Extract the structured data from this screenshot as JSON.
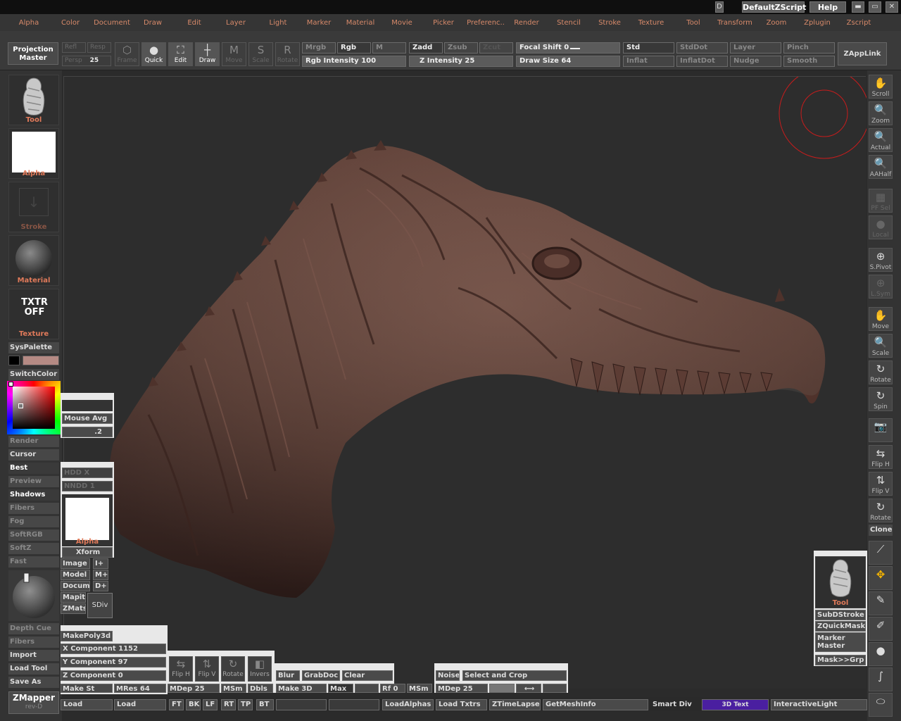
{
  "titlebar": {
    "script_name": "DefaultZScript",
    "help": "Help",
    "win_min": "▬",
    "win_max": "▭",
    "win_close": "✕",
    "d_label": "D"
  },
  "menus": [
    "Alpha",
    "Color",
    "Document",
    "Draw",
    "Edit",
    "Layer",
    "Light",
    "Marker",
    "Material",
    "Movie",
    "Picker",
    "Preferenc..",
    "Render",
    "Stencil",
    "Stroke",
    "Texture",
    "Tool",
    "Transform",
    "Zoom",
    "Zplugin",
    "Zscript"
  ],
  "toolbar": {
    "projection_master": "Projection Master",
    "refl": "Refl",
    "resp": "Resp",
    "persp": "Persp",
    "persp_value": "25",
    "frame": "Frame",
    "quick": "Quick",
    "edit": "Edit",
    "draw": "Draw",
    "move": "Move",
    "scale": "Scale",
    "rotate": "Rotate",
    "mrgb": "Mrgb",
    "rgb": "Rgb",
    "m": "M",
    "zadd": "Zadd",
    "zsub": "Zsub",
    "zcut": "Zcut",
    "rgb_intensity_label": "Rgb Intensity",
    "rgb_intensity_value": "100",
    "z_intensity_label": "Z Intensity",
    "z_intensity_value": "25",
    "focal_shift_label": "Focal Shift",
    "focal_shift_value": "0",
    "draw_size_label": "Draw Size",
    "draw_size_value": "64",
    "brushes": [
      "Std",
      "StdDot",
      "Layer",
      "Pinch",
      "Inflat",
      "InflatDot",
      "Nudge",
      "Smooth"
    ],
    "zapplink": "ZAppLink"
  },
  "left": {
    "tool": "Tool",
    "alpha": "Alpha",
    "stroke": "Stroke",
    "material": "Material",
    "texture_off": "TXTR OFF",
    "texture": "Texture",
    "syspalette": "SysPalette",
    "switchcolor": "SwitchColor",
    "render_buttons": [
      "Render",
      "Cursor",
      "Best",
      "Preview",
      "Shadows",
      "Fibers",
      "Fog",
      "SoftRGB",
      "SoftZ",
      "Fast"
    ],
    "lower_buttons": [
      "Depth Cue",
      "Fibers",
      "Import",
      "Load Tool",
      "Save As"
    ],
    "zmapper": "ZMapper",
    "zmapper_rev": "rev-D"
  },
  "float_panel": {
    "mouse_avg": "Mouse Avg",
    "lazy_value": ".2",
    "hdd1": "HDD X",
    "hdd2": "NNDD 1",
    "alpha": "Alpha",
    "xform": "Xform",
    "image": "Image",
    "i_plus": "I+",
    "model": "Model",
    "m_plus": "M+",
    "docum": "Docum",
    "d_plus": "D+",
    "mapit": "Mapit",
    "zmats": "ZMats",
    "sdiv": "SDiv",
    "makepoly3d": "MakePoly3d",
    "x_comp": "X Component",
    "x_val": "1152",
    "y_comp": "Y Component",
    "y_val": "97",
    "z_comp": "Z Component",
    "z_val": "0",
    "make_st": "Make St",
    "mres": "MRes",
    "mres_val": "64",
    "mdep": "MDep",
    "mdep_val": "25",
    "msm": "MSm",
    "dbls": "Dbls",
    "flip_h": "Flip H",
    "flip_v": "Flip V",
    "rotate": "Rotate",
    "invers": "Invers",
    "blur": "Blur",
    "grabdoc": "GrabDoc",
    "clear": "Clear",
    "make_3d": "Make 3D",
    "max": "Max",
    "rf": "Rf",
    "rf_val": "0",
    "msm2": "MSm",
    "noise": "Noise",
    "select_and_crop": "Select and Crop",
    "mdep2": "MDep",
    "mdep2_val": "25"
  },
  "right": {
    "buttons": [
      "Scroll",
      "Zoom",
      "Actual",
      "AAHalf",
      "PF Sel",
      "Local",
      "S.Pivot",
      "L.Sym",
      "Move",
      "Scale",
      "Rotate",
      "Spin"
    ],
    "lower_buttons": [
      "Flip H",
      "Flip V",
      "Rotate"
    ],
    "clone": "Clone",
    "tool": "Tool",
    "subdstroke": "SubDStroke",
    "zquickmask": "ZQuickMask",
    "marker_master": "Marker Master",
    "mask_grp": "Mask>>Grp"
  },
  "bottom": {
    "load1": "Load",
    "load2": "Load",
    "ft": "FT",
    "bk": "BK",
    "lf": "LF",
    "rt": "RT",
    "tp": "TP",
    "bt": "BT",
    "loadalphas": "LoadAlphas",
    "load_txtrs": "Load Txtrs",
    "ztimelapse": "ZTimeLapse",
    "getmeshinfo": "GetMeshInfo",
    "smart_div": "Smart Div",
    "text_3d": "3D Text",
    "interactivelight": "InteractiveLight"
  },
  "colors": {
    "menu_text": "#d88a6a",
    "caption_text": "#e07a5a",
    "model": "#5a3a32",
    "secondary_color": "#b58a84",
    "cursor_ring": "#c81c1c"
  }
}
